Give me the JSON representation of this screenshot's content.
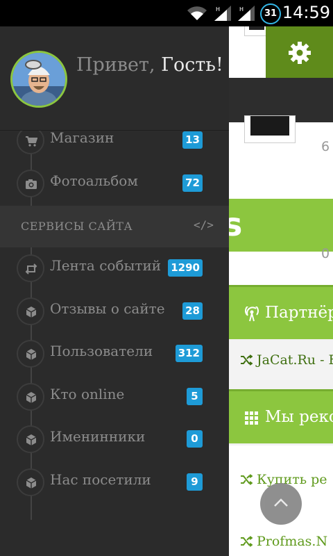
{
  "status_bar": {
    "time": "14:59",
    "calendar_day": "31",
    "icons": [
      "wifi-icon",
      "signal-icon",
      "signal-icon",
      "calendar-icon"
    ]
  },
  "drawer": {
    "greeting_prefix": "Привет, ",
    "greeting_name": "Гость!",
    "menu_top": [
      {
        "label": "Магазин",
        "badge": "13",
        "icon": "cart-icon"
      },
      {
        "label": "Фотоальбом",
        "badge": "72",
        "icon": "camera-icon"
      }
    ],
    "section_title": "СЕРВИСЫ САЙТА",
    "section_icon_text": "</>",
    "menu_services": [
      {
        "label": "Лента событий",
        "badge": "1290",
        "icon": "retweet-icon"
      },
      {
        "label": "Отзывы о сайте",
        "badge": "28",
        "icon": "cube-icon"
      },
      {
        "label": "Пользователи",
        "badge": "312",
        "icon": "cube-icon"
      },
      {
        "label": "Кто online",
        "badge": "5",
        "icon": "cube-icon"
      },
      {
        "label": "Именинники",
        "badge": "0",
        "icon": "cube-icon"
      },
      {
        "label": "Нас посетили",
        "badge": "9",
        "icon": "cube-icon"
      }
    ]
  },
  "background_page": {
    "count_a": "6",
    "count_b": "0",
    "banner_text": "s",
    "partners_title": "Партнёр",
    "partner_link": "JaCat.Ru - E",
    "recommend_title": "Мы реко",
    "link_1": "Купить ре",
    "link_2": "Profmas.N"
  },
  "colors": {
    "accent_green": "#8cc63f",
    "dark_green": "#5f8b1b",
    "badge_blue": "#1e9bd7",
    "drawer_bg": "#2b2b2b"
  }
}
